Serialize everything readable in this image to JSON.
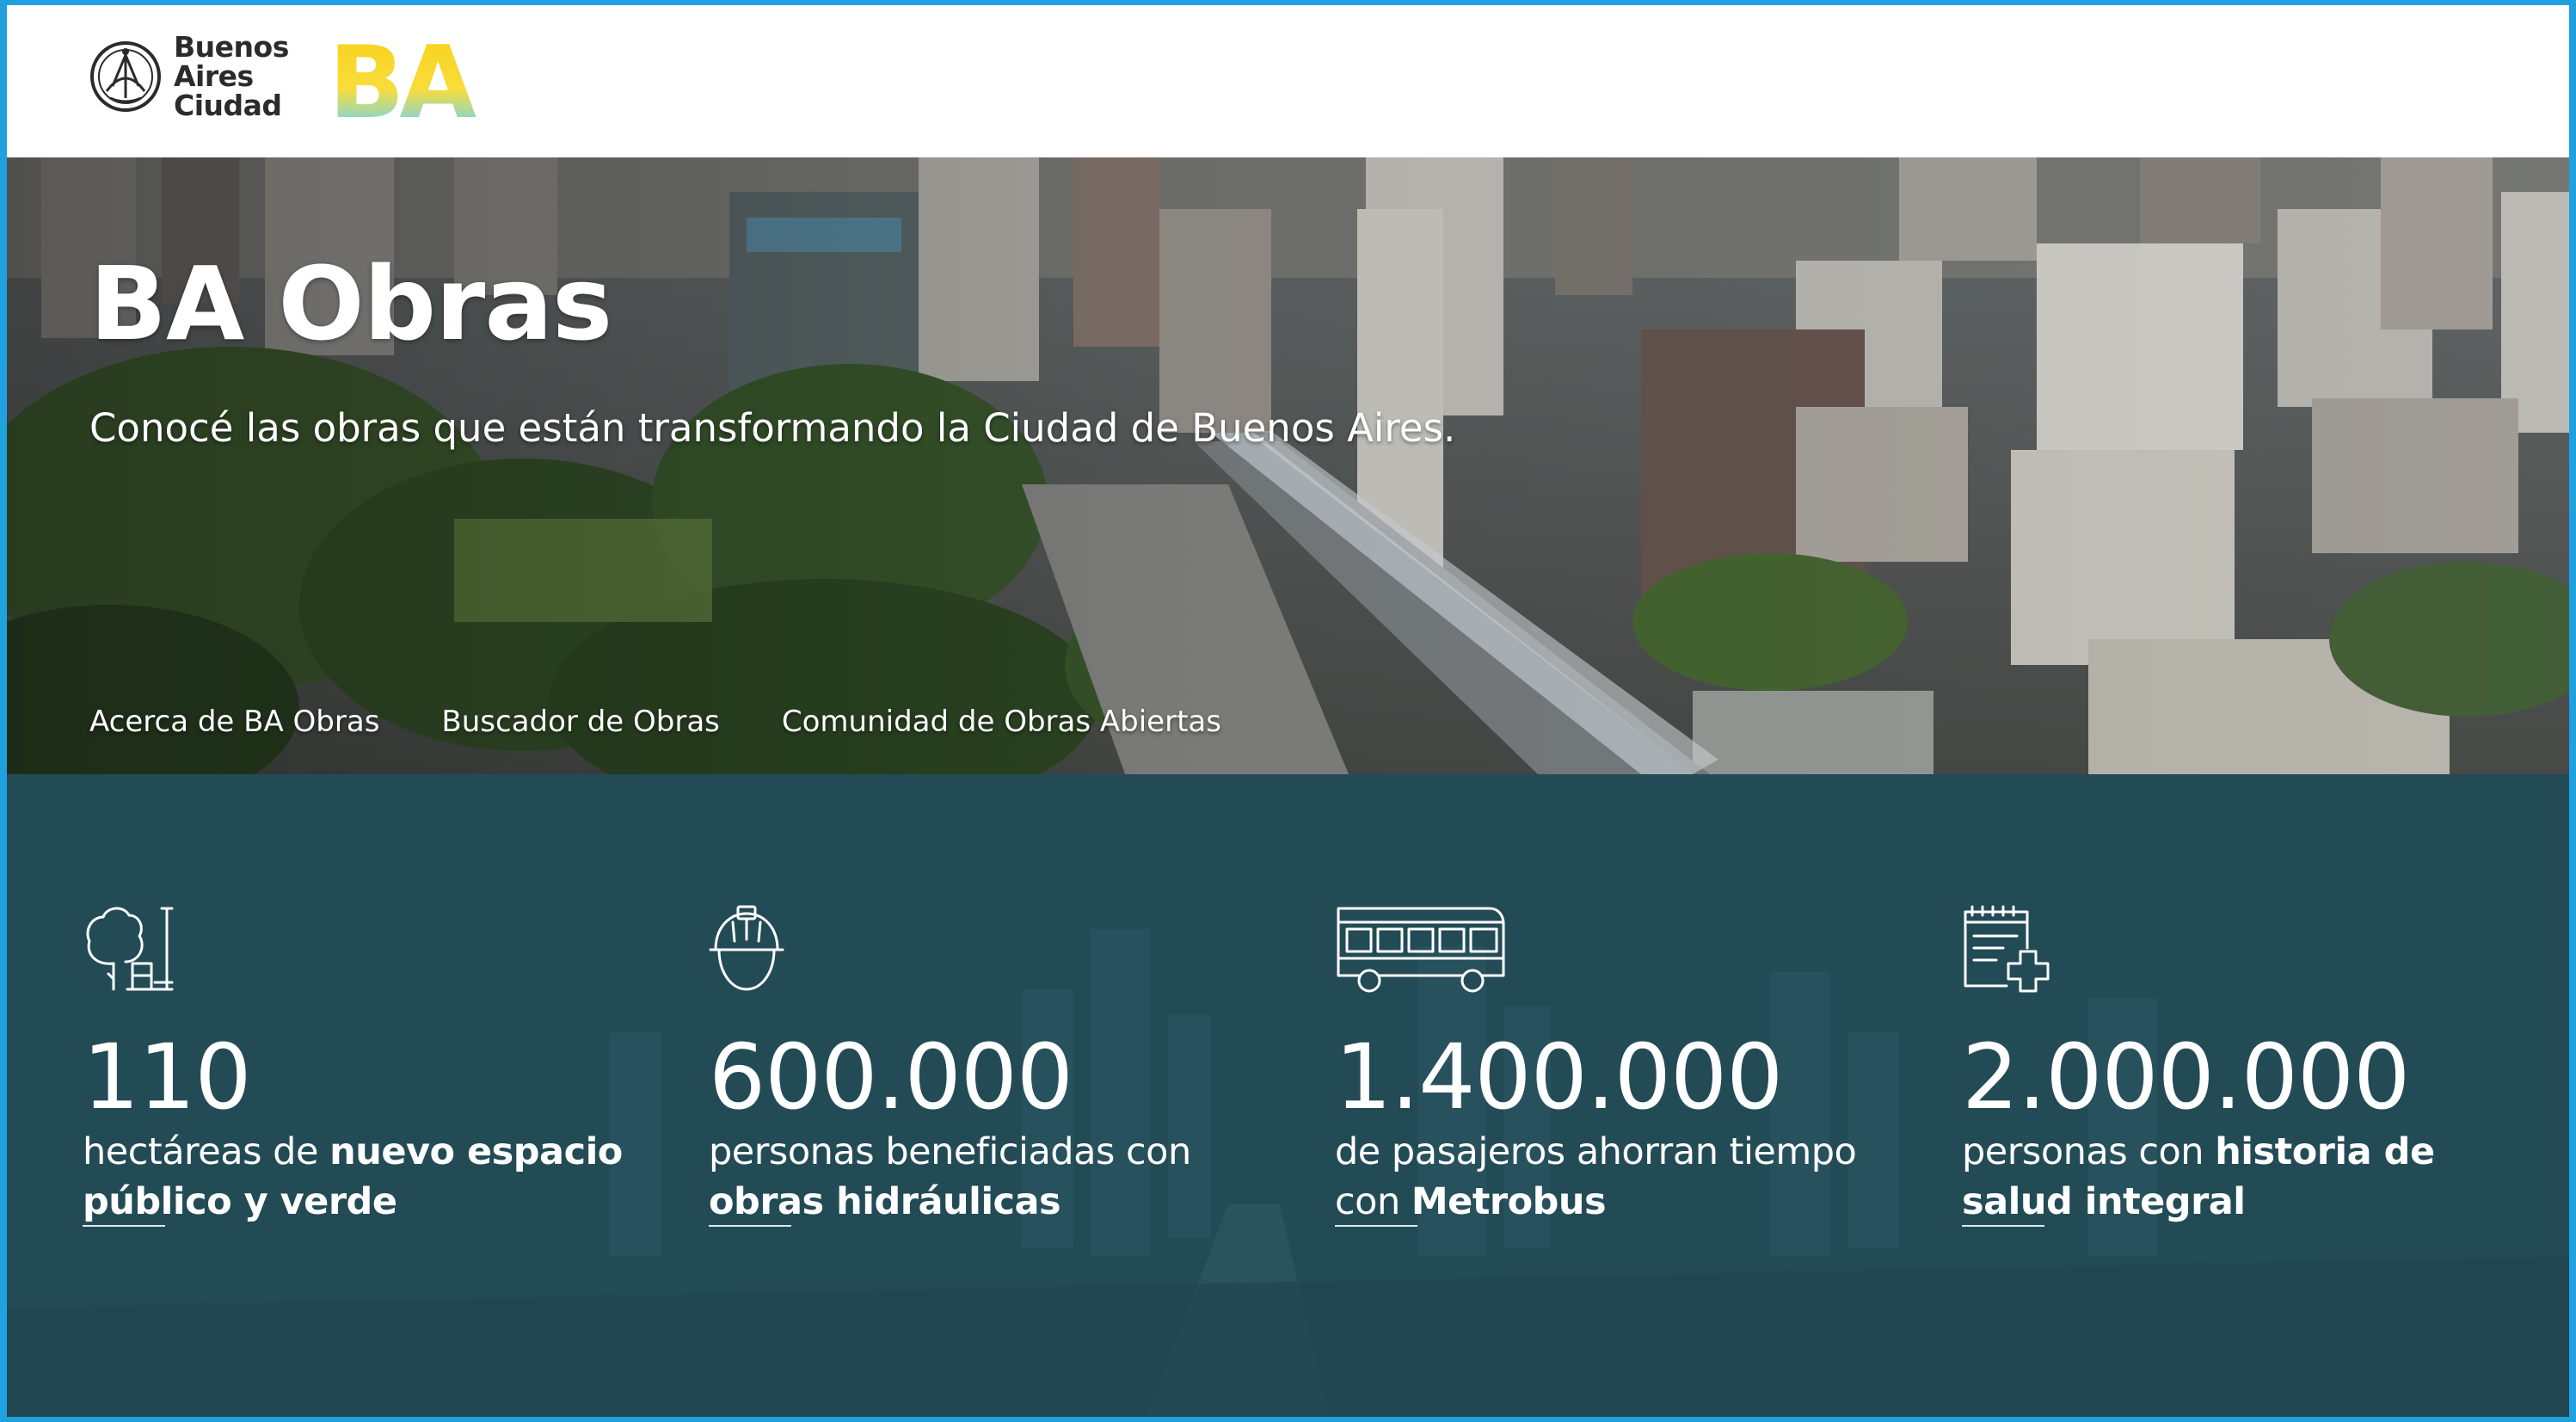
{
  "header": {
    "logo_text_line1": "Buenos",
    "logo_text_line2": "Aires",
    "logo_text_line3": "Ciudad",
    "brand_mark": "BA",
    "colors": {
      "frame": "#1fa1e0",
      "ba_yellow": "#f7d117",
      "ba_cyan": "#2bc4e8"
    }
  },
  "hero": {
    "title": "BA Obras",
    "subtitle": "Conocé las obras que están transformando la Ciudad de Buenos Aires.",
    "nav": [
      {
        "label": "Acerca de BA Obras"
      },
      {
        "label": "Buscador de Obras"
      },
      {
        "label": "Comunidad de Obras Abiertas"
      }
    ]
  },
  "stats": {
    "background_color": "#234b55",
    "items": [
      {
        "icon": "tree-bench-icon",
        "number": "110",
        "desc_plain": "hectáreas de ",
        "desc_bold": "nuevo espacio público y verde"
      },
      {
        "icon": "hard-hat-icon",
        "number": "600.000",
        "desc_plain": "personas beneficiadas con ",
        "desc_bold": "obras hidráulicas"
      },
      {
        "icon": "bus-icon",
        "number": "1.400.000",
        "desc_plain": "de pasajeros ahorran tiempo con ",
        "desc_bold": "Metrobus"
      },
      {
        "icon": "medical-record-icon",
        "number": "2.000.000",
        "desc_plain": "personas con ",
        "desc_bold": "historia de salud integral"
      }
    ]
  }
}
